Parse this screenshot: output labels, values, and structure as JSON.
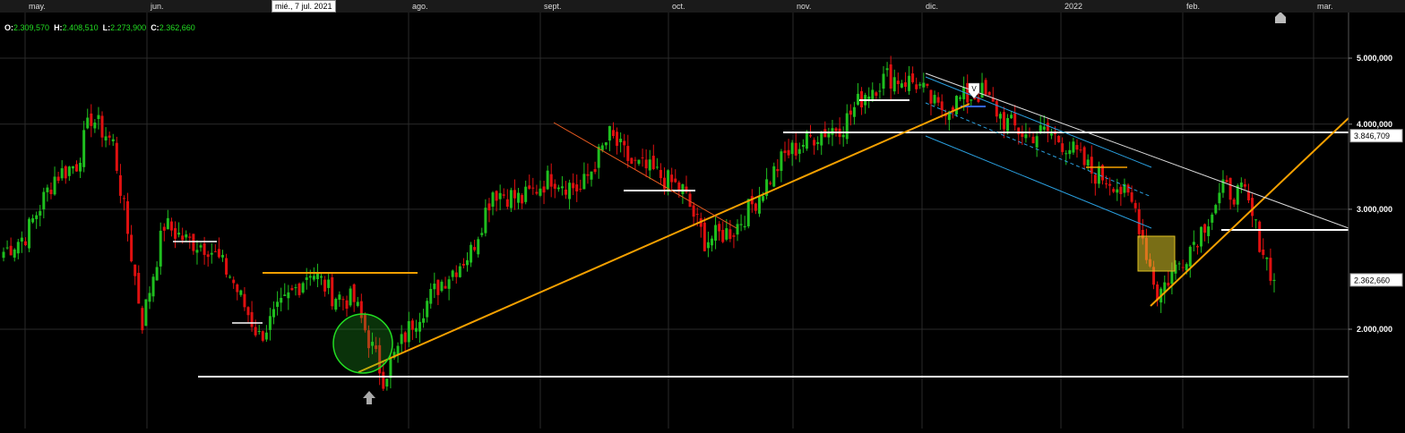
{
  "ohlc": {
    "open_label": "O:",
    "open": "2.309,570",
    "high_label": "H:",
    "high": "2.408,510",
    "low_label": "L:",
    "low": "2.273,900",
    "close_label": "C:",
    "close": "2.362,660"
  },
  "crosshair_date": "mié., 7 jul. 2021",
  "colors": {
    "background": "#000000",
    "grid": "#2a2a2a",
    "up": "#1fbf1f",
    "down": "#e01010",
    "trendline_orange": "#f5a000",
    "channel_blue": "#2aa0e0",
    "support_white": "#ffffff"
  },
  "icons": [
    "arrow-up-icon",
    "home-icon",
    "down-marker-icon"
  ],
  "chart_data": {
    "type": "candlestick",
    "x_tick_labels": [
      "may.",
      "jun.",
      "ago.",
      "sept.",
      "oct.",
      "nov.",
      "dic.",
      "2022",
      "feb.",
      "mar."
    ],
    "y_tick_labels": [
      "5.000,000",
      "4.000,000",
      "3.000,000",
      "2.000,000"
    ],
    "y_ticks": [
      5000000,
      4000000,
      3000000,
      2000000
    ],
    "price_tags": [
      {
        "label": "3.846,709",
        "value": 3846709
      },
      {
        "label": "2.362,660",
        "value": 2362660
      }
    ],
    "y_scale": "log",
    "ylim": [
      1200000,
      6200000
    ],
    "grid": true,
    "last_close": 2362660,
    "anchors": [
      [
        0,
        2600000
      ],
      [
        6,
        2750000
      ],
      [
        14,
        3350000
      ],
      [
        20,
        3500000
      ],
      [
        24,
        4100000
      ],
      [
        30,
        3750000
      ],
      [
        38,
        2050000
      ],
      [
        44,
        2850000
      ],
      [
        50,
        2700000
      ],
      [
        56,
        2650000
      ],
      [
        62,
        2400000
      ],
      [
        70,
        1950000
      ],
      [
        76,
        2150000
      ],
      [
        84,
        2450000
      ],
      [
        90,
        2250000
      ],
      [
        96,
        2200000
      ],
      [
        104,
        1700000
      ],
      [
        112,
        2050000
      ],
      [
        120,
        2350000
      ],
      [
        128,
        2600000
      ],
      [
        134,
        3200000
      ],
      [
        142,
        3100000
      ],
      [
        150,
        3350000
      ],
      [
        158,
        3200000
      ],
      [
        166,
        3850000
      ],
      [
        172,
        3500000
      ],
      [
        178,
        3400000
      ],
      [
        186,
        3200000
      ],
      [
        192,
        2700000
      ],
      [
        200,
        2800000
      ],
      [
        206,
        3100000
      ],
      [
        214,
        3600000
      ],
      [
        222,
        3850000
      ],
      [
        230,
        4000000
      ],
      [
        236,
        4450000
      ],
      [
        242,
        4700000
      ],
      [
        250,
        4600000
      ],
      [
        256,
        4200000
      ],
      [
        262,
        4350000
      ],
      [
        268,
        4450000
      ],
      [
        274,
        4050000
      ],
      [
        280,
        3850000
      ],
      [
        286,
        3900000
      ],
      [
        292,
        3700000
      ],
      [
        298,
        3400000
      ],
      [
        304,
        3300000
      ],
      [
        310,
        3000000
      ],
      [
        316,
        2250000
      ],
      [
        322,
        2500000
      ],
      [
        328,
        2800000
      ],
      [
        334,
        3200000
      ],
      [
        340,
        3150000
      ],
      [
        344,
        2700000
      ],
      [
        348,
        2360000
      ]
    ]
  }
}
